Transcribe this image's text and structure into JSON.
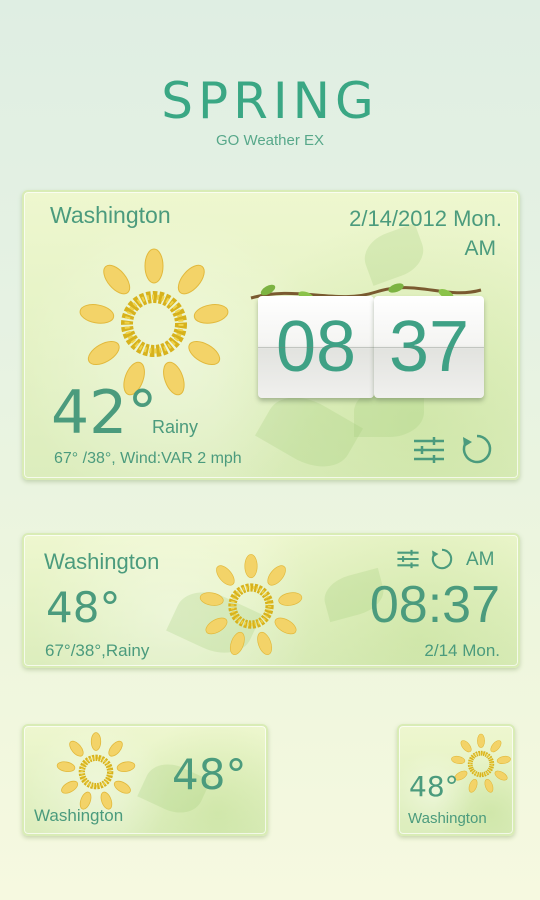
{
  "header": {
    "title": "SPRING",
    "subtitle": "GO Weather EX"
  },
  "widget_large": {
    "city": "Washington",
    "date": "2/14/2012 Mon.",
    "ampm": "AM",
    "hour": "08",
    "minute": "37",
    "temp": "42°",
    "condition": "Rainy",
    "details": "67° /38°,  Wind:VAR 2 mph"
  },
  "widget_medium": {
    "city": "Washington",
    "ampm": "AM",
    "temp": "48°",
    "range": "67°/38°,Rainy",
    "time": "08:37",
    "date": "2/14 Mon."
  },
  "widget_small_wide": {
    "temp": "48°",
    "city": "Washington"
  },
  "widget_small_square": {
    "temp": "48°",
    "city": "Washington"
  },
  "colors": {
    "accent": "#3aa784",
    "text": "#4b9b7d",
    "card_border": "#d9ecb6",
    "sun_petal": "#f3d368",
    "sun_ring": "#d7b21d"
  },
  "icons": {
    "weather": "sun-flower-icon",
    "settings": "sliders-icon",
    "refresh": "refresh-icon"
  }
}
